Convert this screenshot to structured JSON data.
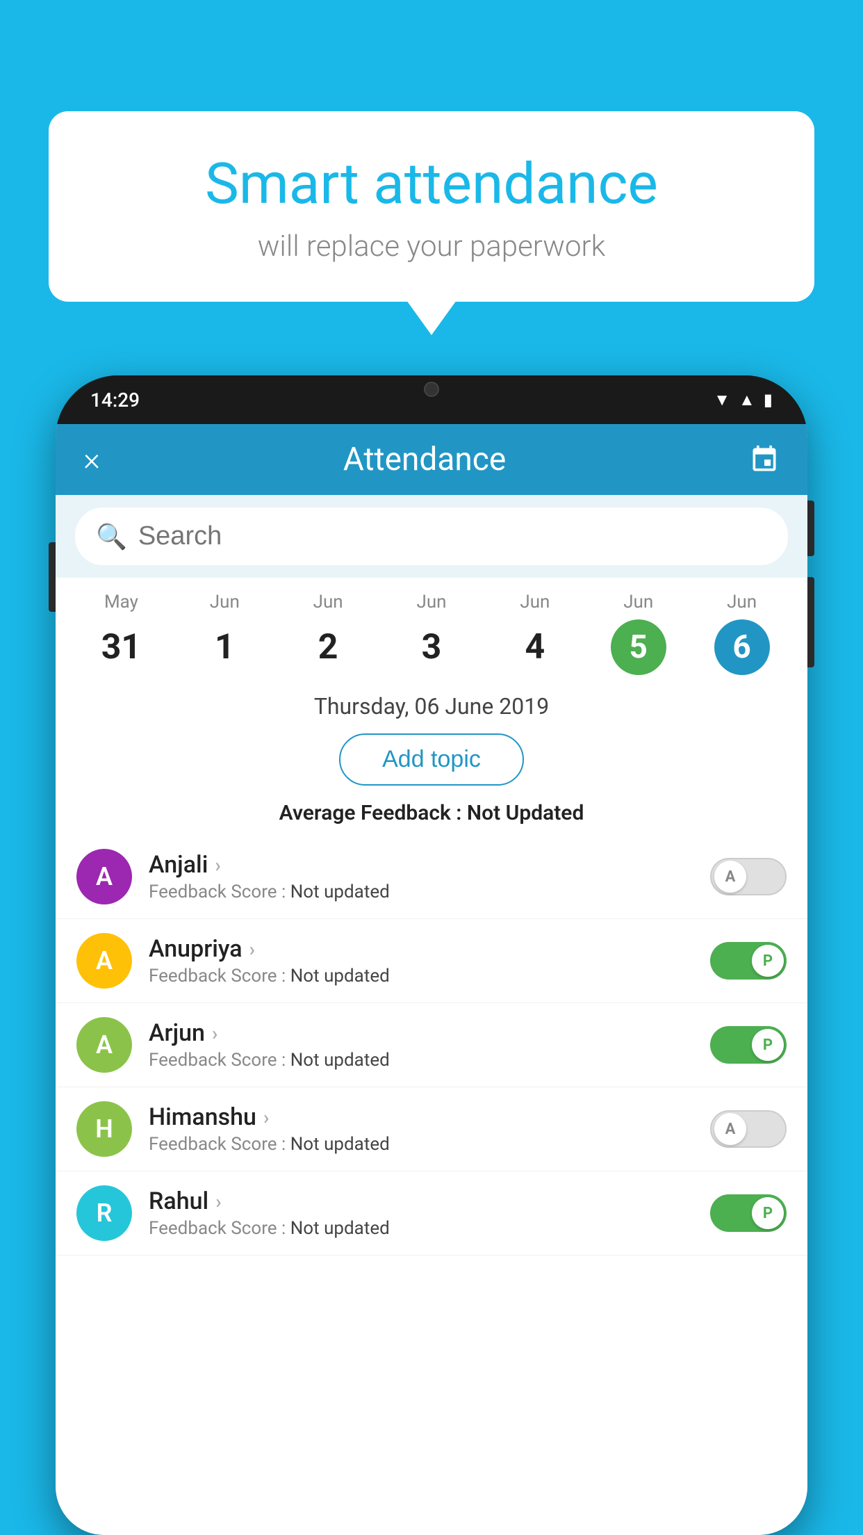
{
  "background_color": "#1ab8e8",
  "speech_bubble": {
    "title": "Smart attendance",
    "subtitle": "will replace your paperwork"
  },
  "phone": {
    "status_bar": {
      "time": "14:29"
    },
    "header": {
      "title": "Attendance",
      "close_label": "×"
    },
    "search": {
      "placeholder": "Search"
    },
    "dates": [
      {
        "month": "May",
        "day": "31",
        "state": "normal"
      },
      {
        "month": "Jun",
        "day": "1",
        "state": "normal"
      },
      {
        "month": "Jun",
        "day": "2",
        "state": "normal"
      },
      {
        "month": "Jun",
        "day": "3",
        "state": "normal"
      },
      {
        "month": "Jun",
        "day": "4",
        "state": "normal"
      },
      {
        "month": "Jun",
        "day": "5",
        "state": "today"
      },
      {
        "month": "Jun",
        "day": "6",
        "state": "selected"
      }
    ],
    "selected_date_label": "Thursday, 06 June 2019",
    "add_topic_label": "Add topic",
    "avg_feedback_label": "Average Feedback :",
    "avg_feedback_value": "Not Updated",
    "students": [
      {
        "name": "Anjali",
        "avatar_letter": "A",
        "avatar_color": "#9c27b0",
        "feedback_label": "Feedback Score :",
        "feedback_value": "Not updated",
        "toggle_state": "off",
        "toggle_letter": "A"
      },
      {
        "name": "Anupriya",
        "avatar_letter": "A",
        "avatar_color": "#ffc107",
        "feedback_label": "Feedback Score :",
        "feedback_value": "Not updated",
        "toggle_state": "on",
        "toggle_letter": "P"
      },
      {
        "name": "Arjun",
        "avatar_letter": "A",
        "avatar_color": "#8bc34a",
        "feedback_label": "Feedback Score :",
        "feedback_value": "Not updated",
        "toggle_state": "on",
        "toggle_letter": "P"
      },
      {
        "name": "Himanshu",
        "avatar_letter": "H",
        "avatar_color": "#8bc34a",
        "feedback_label": "Feedback Score :",
        "feedback_value": "Not updated",
        "toggle_state": "off",
        "toggle_letter": "A"
      },
      {
        "name": "Rahul",
        "avatar_letter": "R",
        "avatar_color": "#26c6da",
        "feedback_label": "Feedback Score :",
        "feedback_value": "Not updated",
        "toggle_state": "on",
        "toggle_letter": "P"
      }
    ]
  }
}
